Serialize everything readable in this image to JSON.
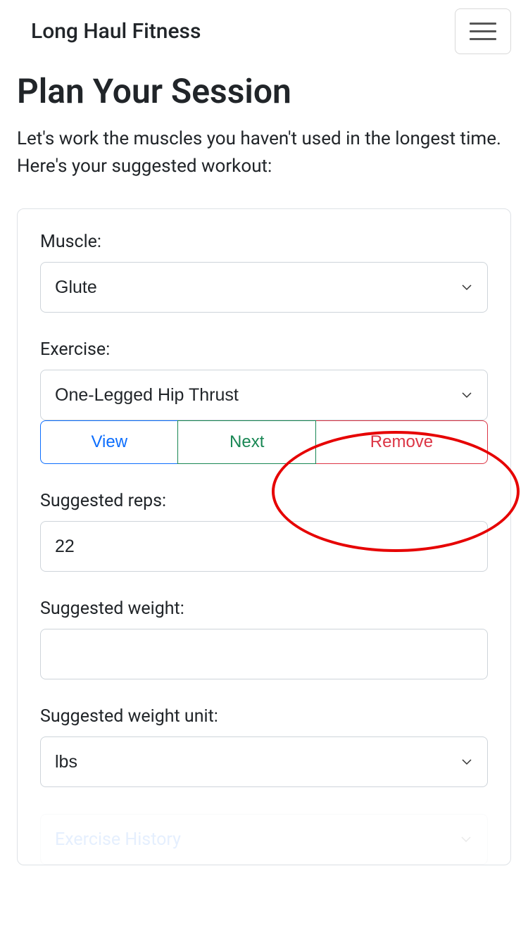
{
  "navbar": {
    "brand": "Long Haul Fitness"
  },
  "page": {
    "title": "Plan Your Session",
    "subtitle": "Let's work the muscles you haven't used in the longest time. Here's your suggested workout:"
  },
  "form": {
    "muscle_label": "Muscle:",
    "muscle_value": "Glute",
    "exercise_label": "Exercise:",
    "exercise_value": "One-Legged Hip Thrust",
    "view_label": "View",
    "next_label": "Next",
    "remove_label": "Remove",
    "reps_label": "Suggested reps:",
    "reps_value": "22",
    "weight_label": "Suggested weight:",
    "weight_value": "",
    "unit_label": "Suggested weight unit:",
    "unit_value": "lbs",
    "history_label": "Exercise History"
  }
}
